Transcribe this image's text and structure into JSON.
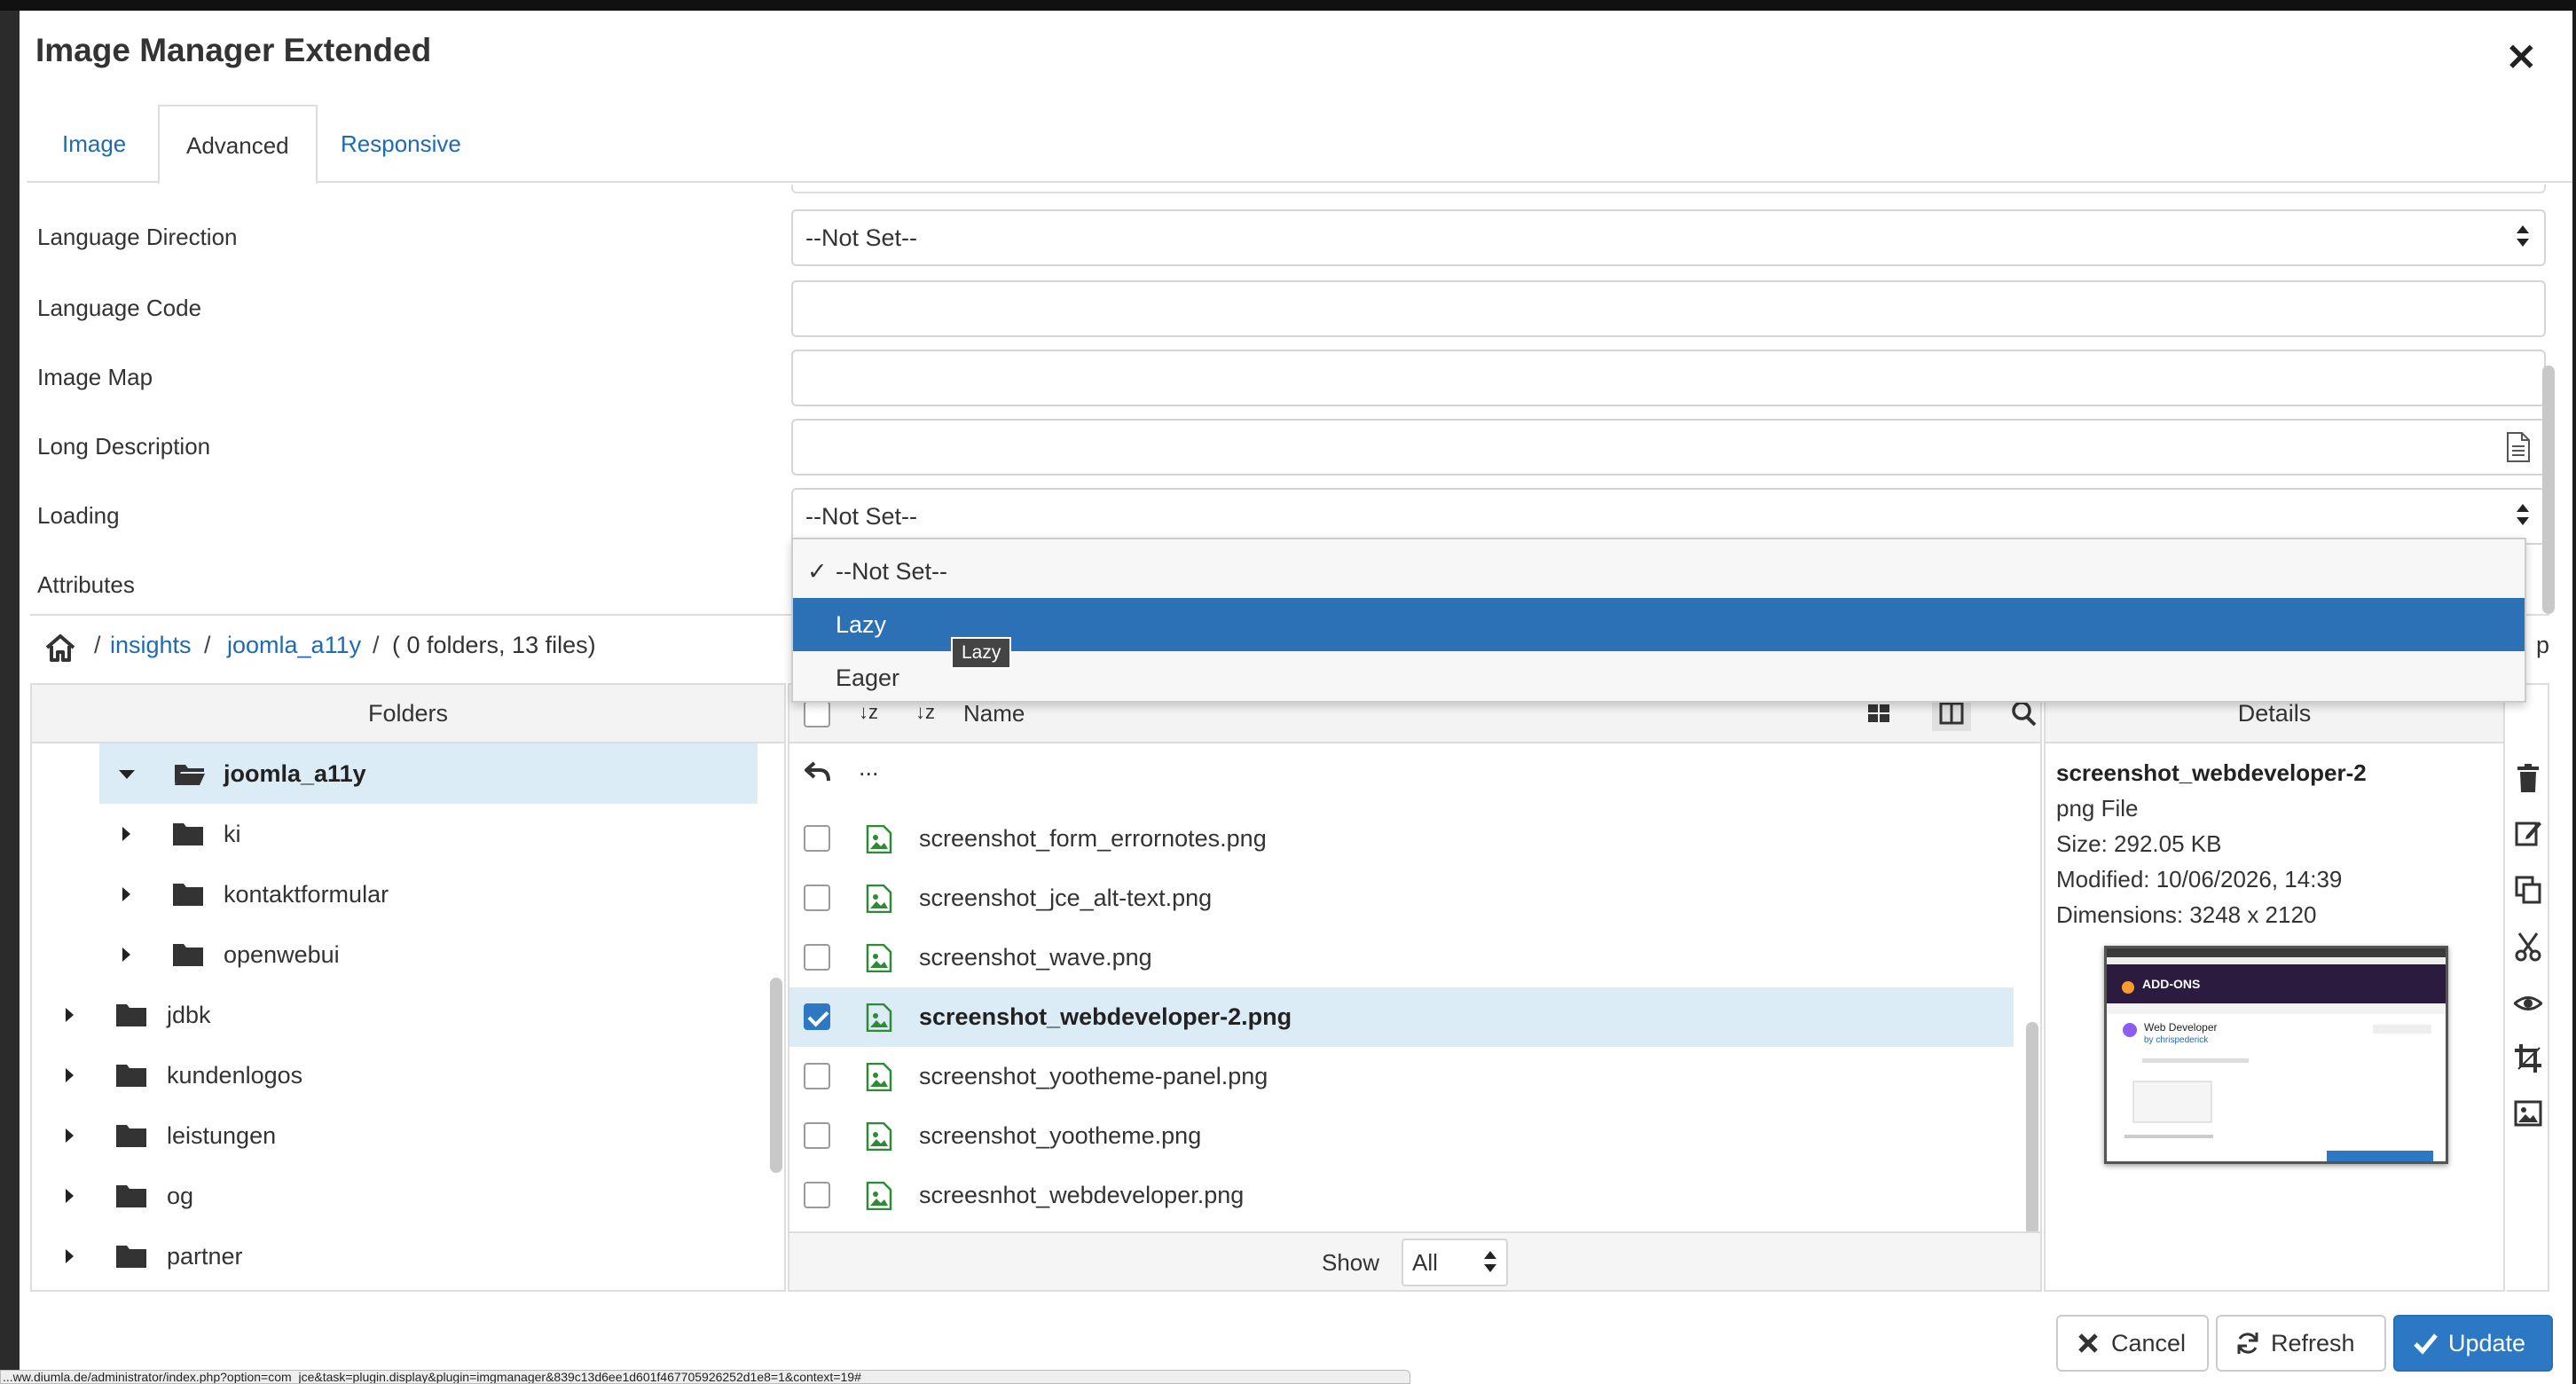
{
  "dialog": {
    "title": "Image Manager Extended"
  },
  "tabs": [
    {
      "label": "Image",
      "active": false
    },
    {
      "label": "Advanced",
      "active": true
    },
    {
      "label": "Responsive",
      "active": false
    }
  ],
  "advanced": {
    "language_direction": {
      "label": "Language Direction",
      "value": "--Not Set--"
    },
    "language_code": {
      "label": "Language Code",
      "value": ""
    },
    "image_map": {
      "label": "Image Map",
      "value": ""
    },
    "long_description": {
      "label": "Long Description",
      "value": ""
    },
    "loading": {
      "label": "Loading",
      "value": "--Not Set--",
      "options": [
        "--Not Set--",
        "Lazy",
        "Eager"
      ],
      "highlighted": "Lazy",
      "tooltip": "Lazy"
    },
    "attributes": {
      "label": "Attributes"
    }
  },
  "breadcrumb": {
    "items": [
      "insights",
      "joomla_a11y"
    ],
    "summary": "( 0 folders, 13 files)",
    "sep": "/",
    "right_fragment": "p"
  },
  "folders": {
    "header": "Folders",
    "items": [
      {
        "name": "joomla_a11y",
        "level": 1,
        "expanded": true,
        "selected": true
      },
      {
        "name": "ki",
        "level": 2
      },
      {
        "name": "kontaktformular",
        "level": 2
      },
      {
        "name": "openwebui",
        "level": 2
      },
      {
        "name": "jdbk",
        "level": 1
      },
      {
        "name": "kundenlogos",
        "level": 1
      },
      {
        "name": "leistungen",
        "level": 1
      },
      {
        "name": "og",
        "level": 1
      },
      {
        "name": "partner",
        "level": 1
      }
    ]
  },
  "files": {
    "name_header": "Name",
    "sort_labels": [
      "↓z",
      "↓z"
    ],
    "up_label": "...",
    "items": [
      {
        "name": "screenshot_form_errornotes.png",
        "checked": false
      },
      {
        "name": "screenshot_jce_alt-text.png",
        "checked": false
      },
      {
        "name": "screenshot_wave.png",
        "checked": false
      },
      {
        "name": "screenshot_webdeveloper-2.png",
        "checked": true
      },
      {
        "name": "screenshot_yootheme-panel.png",
        "checked": false
      },
      {
        "name": "screenshot_yootheme.png",
        "checked": false
      },
      {
        "name": "screesnhot_webdeveloper.png",
        "checked": false
      }
    ],
    "show_label": "Show",
    "show_value": "All"
  },
  "details": {
    "header": "Details",
    "name": "screenshot_webdeveloper-2",
    "type": "png File",
    "size": "Size: 292.05 KB",
    "modified": "Modified: 10/06/2026, 14:39",
    "dimensions": "Dimensions: 3248 x 2120",
    "thumb_brand": "ADD-ONS",
    "thumb_title": "Web Developer",
    "thumb_author": "by chrispederick"
  },
  "actions": [
    "trash-icon",
    "edit-icon",
    "copy-icon",
    "cut-icon",
    "view-icon",
    "crop-icon",
    "image-icon"
  ],
  "footer": {
    "cancel": "Cancel",
    "refresh": "Refresh",
    "update": "Update"
  },
  "status_url": "...ww.diumla.de/administrator/index.php?option=com_jce&task=plugin.display&plugin=imgmanager&839c13d6ee1d601f467705926252d1e8=1&context=19#",
  "colors": {
    "accent": "#2c78c5",
    "link": "#1f6ab3",
    "selection": "#dcecf6",
    "highlight": "#2c70b5"
  }
}
